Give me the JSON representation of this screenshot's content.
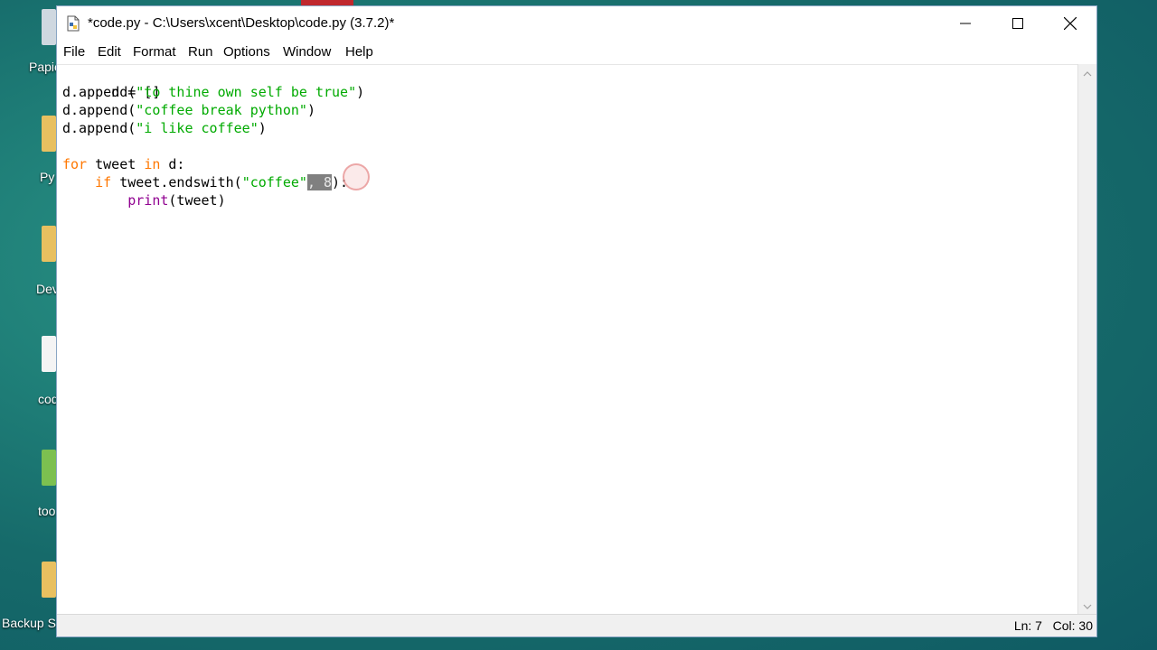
{
  "desktop": {
    "icons": [
      {
        "label": "Papie",
        "name": "desktop-icon-papie"
      },
      {
        "label": "Py",
        "name": "desktop-icon-py"
      },
      {
        "label": "Dev",
        "name": "desktop-icon-dev"
      },
      {
        "label": "cod",
        "name": "desktop-icon-cod"
      },
      {
        "label": "too",
        "name": "desktop-icon-too"
      },
      {
        "label": "Backup S",
        "name": "desktop-icon-backup"
      }
    ]
  },
  "window": {
    "title": "*code.py - C:\\Users\\xcent\\Desktop\\code.py (3.7.2)*",
    "minimize_icon": "minimize-icon",
    "maximize_icon": "maximize-icon",
    "close_icon": "close-icon"
  },
  "menu": {
    "items": [
      "File",
      "Edit",
      "Format",
      "Run",
      "Options",
      "Window",
      "Help"
    ]
  },
  "code": {
    "line1": "d = []",
    "line2_pre": "d.append(",
    "line2_str": "\"to thine own self be true\"",
    "line2_post": ")",
    "line3_pre": "d.append(",
    "line3_str": "\"coffee break python\"",
    "line3_post": ")",
    "line4_pre": "d.append(",
    "line4_str": "\"i like coffee\"",
    "line4_post": ")",
    "line6_kw1": "for",
    "line6_mid": " tweet ",
    "line6_kw2": "in",
    "line6_post": " d:",
    "line7_indent": "    ",
    "line7_kw": "if",
    "line7_mid": " tweet.endswith(",
    "line7_str": "\"coffee\"",
    "line7_sel": ", 8",
    "line7_post": "):",
    "line8_indent": "        ",
    "line8_bi": "print",
    "line8_post": "(tweet)"
  },
  "status": {
    "text": "Ln: 7   Col: 30"
  },
  "colors": {
    "keyword": "#ff7700",
    "string": "#00aa00",
    "builtin": "#900090",
    "selection": "#808080"
  }
}
